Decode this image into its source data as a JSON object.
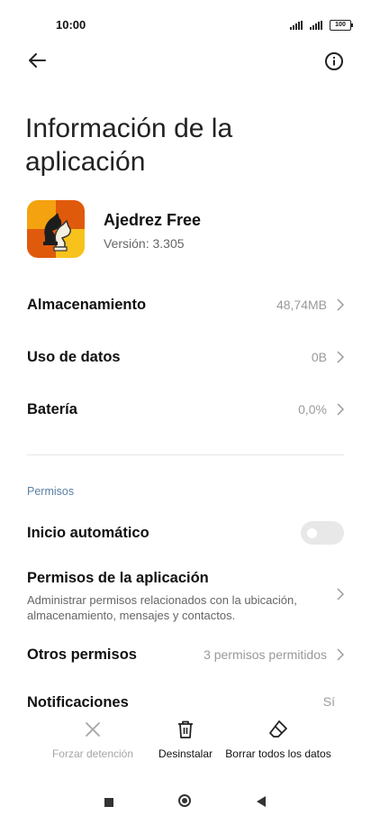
{
  "status": {
    "time": "10:00",
    "battery": "100"
  },
  "header": {
    "title": "Información de la aplicación"
  },
  "app": {
    "name": "Ajedrez Free",
    "version": "Versión: 3.305"
  },
  "rows": {
    "storage": {
      "label": "Almacenamiento",
      "value": "48,74MB"
    },
    "data": {
      "label": "Uso de datos",
      "value": "0B"
    },
    "battery": {
      "label": "Batería",
      "value": "0,0%"
    }
  },
  "permissions": {
    "section_label": "Permisos",
    "autostart": {
      "label": "Inicio automático",
      "enabled": false
    },
    "app_permissions": {
      "label": "Permisos de la aplicación",
      "description": "Administrar permisos relacionados con la ubicación, almacenamiento, mensajes y contactos."
    },
    "other": {
      "label": "Otros permisos",
      "value": "3 permisos permitidos"
    },
    "notifications": {
      "label": "Notificaciones",
      "value": "Sí"
    }
  },
  "actions": {
    "force_stop": "Forzar detención",
    "uninstall": "Desinstalar",
    "clear_data": "Borrar todos los datos"
  },
  "icons": {
    "back": "arrow-left-icon",
    "info": "info-circle-icon",
    "force_stop": "close-x-icon",
    "uninstall": "trash-icon",
    "clear_data": "eraser-icon"
  },
  "colors": {
    "section_label": "#5b7fa6",
    "secondary_text": "#9a9a9a",
    "toggle_off": "#e8e8e8"
  }
}
